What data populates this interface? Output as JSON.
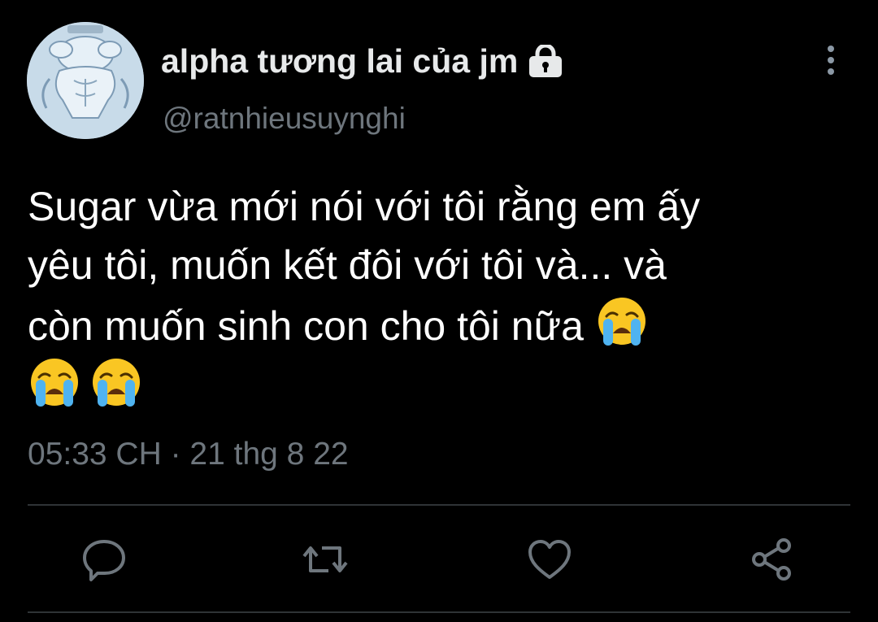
{
  "tweet": {
    "display_name": "alpha tương lai của jm",
    "handle": "@ratnhieusuynghi",
    "text_lines": [
      "Sugar vừa mới nói với tôi rằng em ấy",
      "yêu tôi, muốn kết đôi với tôi và... và",
      "còn muốn sinh con cho tôi nữa"
    ],
    "emojis": [
      "loudly-crying-face",
      "loudly-crying-face",
      "loudly-crying-face"
    ],
    "timestamp": "05:33 CH · 21 thg 8 22",
    "protected": true
  },
  "actions": [
    "reply",
    "retweet",
    "like",
    "share"
  ],
  "colors": {
    "background": "#000000",
    "text_primary": "#e7e9ea",
    "text_secondary": "#6e767d",
    "divider": "#2f3336",
    "icon": "#6e767d"
  }
}
